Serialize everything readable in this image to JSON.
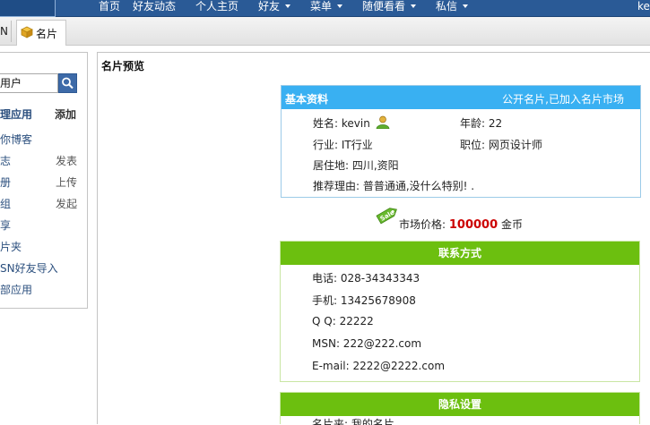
{
  "nav": {
    "items": [
      {
        "label": "首页",
        "caret": false
      },
      {
        "label": "好友动态",
        "caret": false
      },
      {
        "label": "个人主页",
        "caret": false
      },
      {
        "label": "好友",
        "caret": true
      },
      {
        "label": "菜单",
        "caret": true
      },
      {
        "label": "随便看看",
        "caret": true
      },
      {
        "label": "私信",
        "caret": true
      }
    ],
    "user": "ke"
  },
  "tabs": {
    "partial": "N",
    "active": "名片"
  },
  "sidebar": {
    "search_value": "用户",
    "apps_heading": "理应用",
    "apps_add": "添加",
    "rows": [
      {
        "label": "你博客",
        "action": ""
      },
      {
        "label": "志",
        "action": "发表"
      },
      {
        "label": "册",
        "action": "上传"
      },
      {
        "label": "组",
        "action": "发起"
      },
      {
        "label": "享",
        "action": ""
      },
      {
        "label": "片夹",
        "action": ""
      },
      {
        "label": "SN好友导入",
        "action": ""
      },
      {
        "label": "部应用",
        "action": ""
      }
    ]
  },
  "main": {
    "title": "名片预览",
    "basic": {
      "heading": "基本资料",
      "status": "公开名片,已加入名片市场",
      "name": "姓名: kevin",
      "age": "年龄: 22",
      "industry": "行业: IT行业",
      "position": "职位: 网页设计师",
      "residence": "居住地: 四川,资阳",
      "reason": "推荐理由: 普普通通,没什么特别!  ."
    },
    "price": {
      "label": "市场价格:",
      "value": "100000",
      "unit": "金币",
      "tag": "Sale"
    },
    "contact": {
      "heading": "联系方式",
      "phone": "电话: 028-34343343",
      "mobile": "手机: 13425678908",
      "qq": "Q  Q: 22222",
      "msn": "MSN: 222@222.com",
      "email": "E-mail: 2222@2222.com"
    },
    "privacy": {
      "heading": "隐私设置",
      "partial_row": "名片夹: 我的名片"
    }
  }
}
